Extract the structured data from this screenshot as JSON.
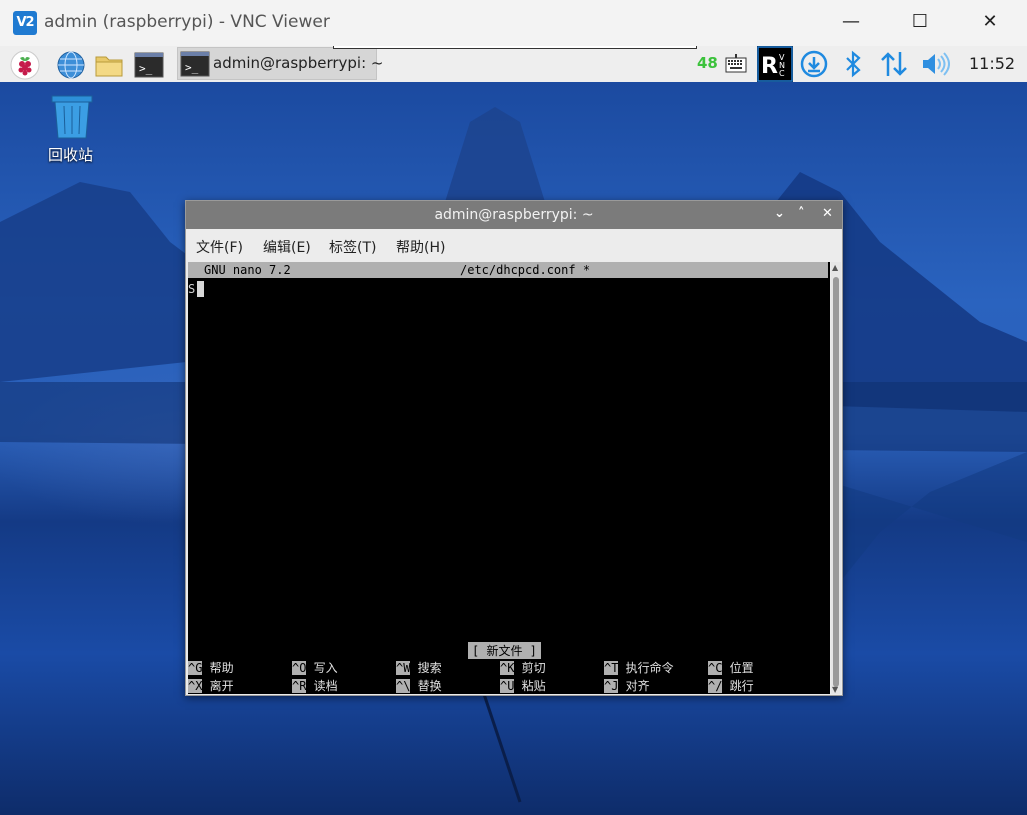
{
  "vnc": {
    "logo_text": "V2",
    "title": "admin (raspberrypi) - VNC Viewer",
    "minimize": "—",
    "maximize": "☐",
    "close": "✕"
  },
  "taskbar": {
    "window_label": "admin@raspberrypi: ~",
    "cpu": "48",
    "clock": "11:52",
    "icons": [
      "raspberry-menu-icon",
      "browser-icon",
      "file-manager-icon",
      "terminal-icon",
      "keyboard-icon",
      "realvnc-icon",
      "download-icon",
      "bluetooth-icon",
      "network-icon",
      "volume-icon"
    ]
  },
  "desktop": {
    "trash_label": "回收站"
  },
  "terminal": {
    "title": "admin@raspberrypi: ~",
    "controls": {
      "minimize": "⌄",
      "maximize": "˄",
      "close": "✕"
    },
    "menu": [
      "文件(F)",
      "编辑(E)",
      "标签(T)",
      "帮助(H)"
    ],
    "nano": {
      "version": "GNU nano 7.2",
      "filename": "/etc/dhcpcd.conf *",
      "text": "S",
      "status": "[ 新文件 ]",
      "shortcuts": [
        {
          "key": "^G",
          "label": " 帮助"
        },
        {
          "key": "^O",
          "label": " 写入"
        },
        {
          "key": "^W",
          "label": " 搜索"
        },
        {
          "key": "^K",
          "label": " 剪切"
        },
        {
          "key": "^T",
          "label": " 执行命令"
        },
        {
          "key": "^C",
          "label": " 位置"
        },
        {
          "key": "^X",
          "label": " 离开"
        },
        {
          "key": "^R",
          "label": " 读档"
        },
        {
          "key": "^\\",
          "label": " 替换"
        },
        {
          "key": "^U",
          "label": " 粘贴"
        },
        {
          "key": "^J",
          "label": " 对齐"
        },
        {
          "key": "^/",
          "label": " 跳行"
        }
      ]
    }
  },
  "colors": {
    "accent": "#1f7ad1",
    "cpu_green": "#3cc23c",
    "terminal_bg": "#000000",
    "nano_bar": "#b0b0b0"
  }
}
